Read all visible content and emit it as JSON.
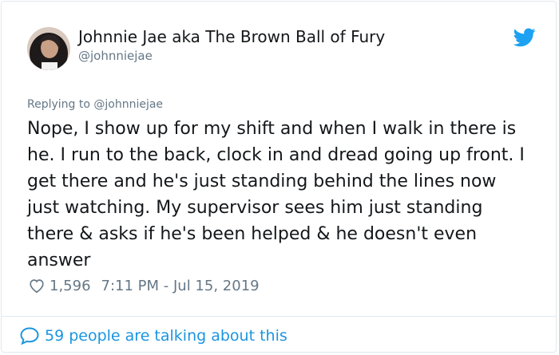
{
  "author": {
    "display_name": "Johnnie Jae aka The Brown Ball of Fury",
    "handle": "@johnniejae"
  },
  "reply": {
    "prefix": "Replying to",
    "mention": "@johnniejae"
  },
  "tweet": {
    "text": "Nope, I show up for my shift and when I walk in there is he. I run to the back, clock in and dread going up front. I get there and he's just standing behind the lines now just watching. My supervisor sees him just standing there & asks if he's been helped & he doesn't even answer"
  },
  "meta": {
    "like_count": "1,596",
    "timestamp": "7:11 PM - Jul 15, 2019"
  },
  "footer": {
    "talking_text": "59 people are talking about this"
  },
  "colors": {
    "twitter_blue": "#1da1f2",
    "link_blue": "#1b95e0",
    "muted": "#657786",
    "text": "#14171a",
    "border": "#e1e8ed"
  },
  "icons": {
    "logo": "twitter-bird-icon",
    "like": "heart-icon",
    "conversation": "speech-bubble-icon"
  }
}
